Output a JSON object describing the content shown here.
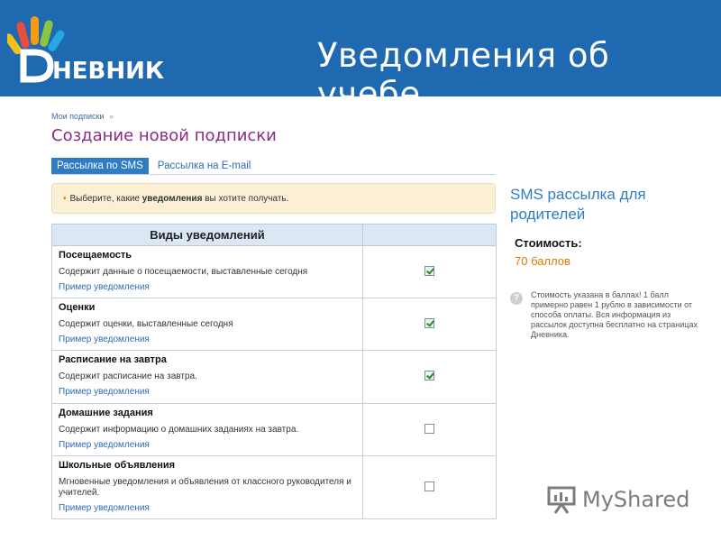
{
  "header": {
    "logo_text": "НЕВНИК",
    "slide_title": "Уведомления об учебе",
    "brand_color": "#1f69b1"
  },
  "breadcrumb": {
    "item": "Мои подписки",
    "separator": "»"
  },
  "page_title": "Создание новой подписки",
  "tabs": [
    {
      "label": "Рассылка по SMS",
      "active": true
    },
    {
      "label": "Рассылка на E-mail",
      "active": false
    }
  ],
  "notice": {
    "bullet": "•",
    "before": "Выберите, какие ",
    "bold": "уведомления",
    "after": " вы хотите получать."
  },
  "table": {
    "header": "Виды уведомлений",
    "rows": [
      {
        "title": "Посещаемость",
        "desc": "Содержит данные о посещаемости, выставленные сегодня",
        "link": "Пример уведомления",
        "checked": true
      },
      {
        "title": "Оценки",
        "desc": "Содержит оценки, выставленные сегодня",
        "link": "Пример уведомления",
        "checked": true
      },
      {
        "title": "Расписание на завтра",
        "desc": "Содержит расписание на завтра.",
        "link": "Пример уведомления",
        "checked": true
      },
      {
        "title": "Домашние задания",
        "desc": "Содержит информацию о домашних заданиях на завтра.",
        "link": "Пример уведомления",
        "checked": false
      },
      {
        "title": "Школьные объявления",
        "desc": "Мгновенные уведомления и объявления от классного руководителя и учителей.",
        "link": "Пример уведомления",
        "checked": false
      }
    ]
  },
  "sidebar": {
    "title": "SMS рассылка для родителей",
    "price_label": "Стоимость:",
    "price_value": "70 баллов",
    "help_icon_glyph": "?",
    "note": "Стоимость указана в баллах! 1 балл примерно равен 1 рублю в зависимости от способа оплаты. Вся информация из рассылок доступна бесплатно на страницах Дневника."
  },
  "watermark": {
    "text": "MyShared"
  }
}
